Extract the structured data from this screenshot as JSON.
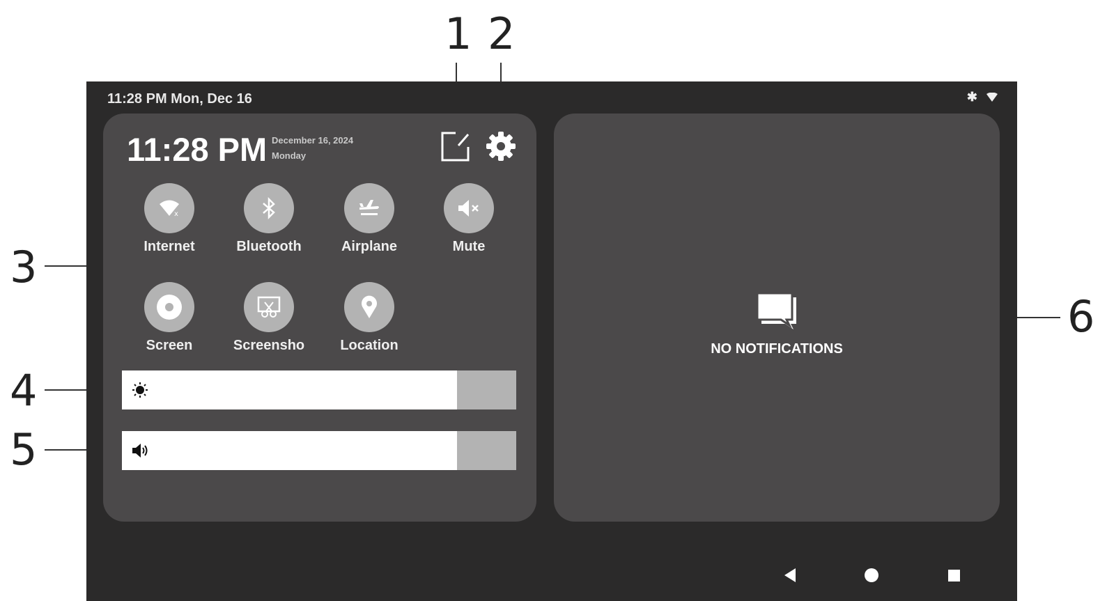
{
  "callouts": [
    "1",
    "2",
    "3",
    "4",
    "5",
    "6"
  ],
  "status_bar": {
    "time_date": "11:28 PM  Mon, Dec 16",
    "icons": [
      "bluetooth-icon",
      "wifi-icon"
    ]
  },
  "quick_settings": {
    "clock": "11:28 PM",
    "date": "December 16, 2024",
    "weekday": "Monday",
    "tiles": [
      {
        "label": "Internet",
        "icon": "wifi-icon"
      },
      {
        "label": "Bluetooth",
        "icon": "bluetooth-icon"
      },
      {
        "label": "Airplane",
        "icon": "airplane-icon"
      },
      {
        "label": "Mute",
        "icon": "mute-icon"
      },
      {
        "label": "Screen",
        "icon": "screen-record-icon"
      },
      {
        "label": "Screensho",
        "icon": "screenshot-icon"
      },
      {
        "label": "Location",
        "icon": "location-icon"
      }
    ],
    "brightness_level": 0.85,
    "volume_level": 0.85
  },
  "notifications": {
    "empty_text": "NO NOTIFICATIONS"
  },
  "navigation": [
    "back-icon",
    "home-icon",
    "recents-icon"
  ],
  "colors": {
    "screen_bg": "#2b2a2a",
    "panel_bg": "#4b494a",
    "tile_bg": "#b3b3b3",
    "slider_fill": "#ffffff"
  }
}
